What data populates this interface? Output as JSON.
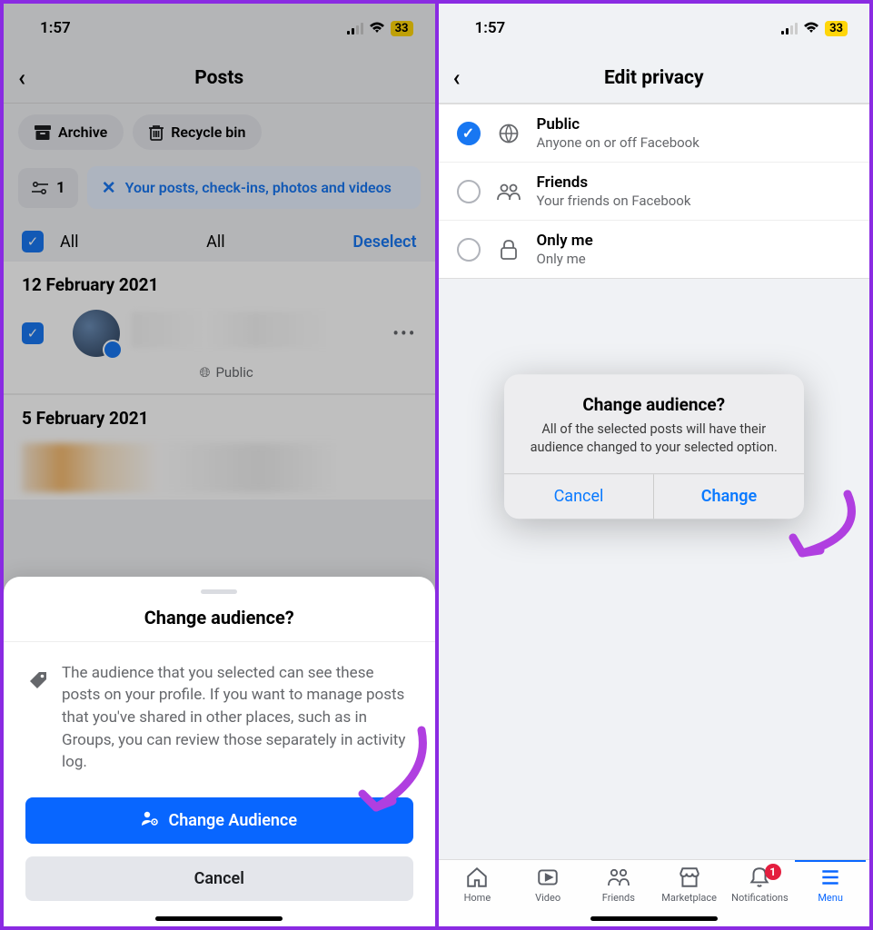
{
  "status": {
    "time": "1:57",
    "battery": "33"
  },
  "left": {
    "title": "Posts",
    "chips": {
      "archive": "Archive",
      "recycle": "Recycle bin"
    },
    "filter_count": "1",
    "filter_msg": "Your posts, check-ins, photos and videos",
    "select": {
      "all_left": "All",
      "all_mid": "All",
      "deselect": "Deselect"
    },
    "date1": "12 February 2021",
    "public_label": "Public",
    "date2": "5 February 2021",
    "sheet": {
      "title": "Change audience?",
      "text": "The audience that you selected can see these posts on your profile. If you want to manage posts that you've shared in other places, such as in Groups, you can review those separately in activity log.",
      "primary": "Change Audience",
      "cancel": "Cancel"
    }
  },
  "right": {
    "title": "Edit privacy",
    "options": [
      {
        "title": "Public",
        "sub": "Anyone on or off Facebook",
        "checked": true,
        "icon": "globe"
      },
      {
        "title": "Friends",
        "sub": "Your friends on Facebook",
        "checked": false,
        "icon": "friends"
      },
      {
        "title": "Only me",
        "sub": "Only me",
        "checked": false,
        "icon": "lock"
      }
    ],
    "dialog": {
      "title": "Change audience?",
      "msg": "All of the selected posts will have their audience changed to your selected option.",
      "cancel": "Cancel",
      "confirm": "Change"
    },
    "tabs": {
      "home": "Home",
      "video": "Video",
      "friends": "Friends",
      "marketplace": "Marketplace",
      "notifications": "Notifications",
      "notif_badge": "1",
      "menu": "Menu"
    }
  }
}
